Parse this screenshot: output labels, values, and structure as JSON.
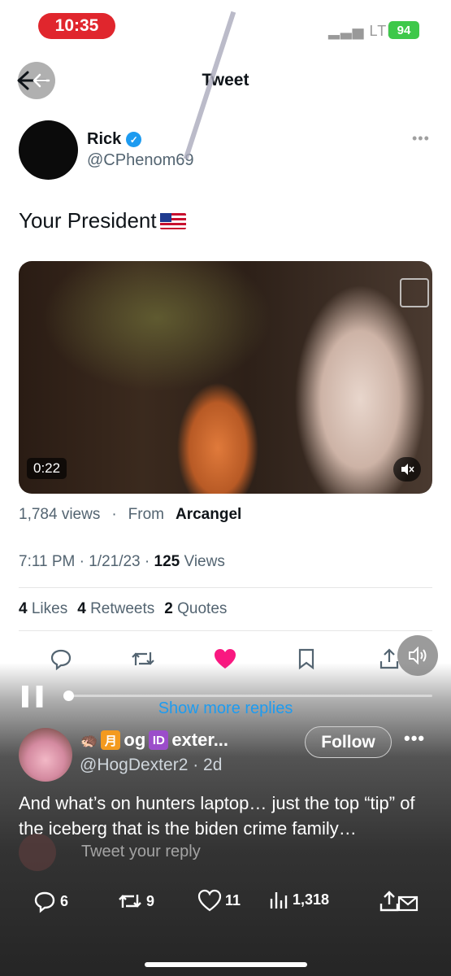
{
  "status_bar": {
    "time": "10:35",
    "network": "LTE",
    "battery": "94"
  },
  "header": {
    "title": "Tweet"
  },
  "tweet": {
    "author_name": "Rick",
    "author_handle": "@CPhenom69",
    "text": "Your President",
    "video_duration": "0:22",
    "views": "1,784 views",
    "separator": "·",
    "from_label": "From",
    "from_source": "Arcangel",
    "timestamp": "7:11 PM · 1/21/23 ·",
    "view_count": "125",
    "view_label": "Views",
    "likes_count": "4",
    "likes_label": "Likes",
    "retweets_count": "4",
    "retweets_label": "Retweets",
    "quotes_count": "2",
    "quotes_label": "Quotes"
  },
  "overlay": {
    "show_more": "Show more replies"
  },
  "reply": {
    "name_prefix": "og",
    "name_suffix": "exter...",
    "handle": "@HogDexter2 · 2d",
    "follow_label": "Follow",
    "text": "And what’s on hunters laptop… just the top “tip” of the iceberg that is the biden crime family…",
    "compose_placeholder": "Tweet your reply",
    "comments": "6",
    "retweets": "9",
    "likes": "11",
    "views": "1,318"
  },
  "colors": {
    "accent": "#1d9bf0",
    "like": "#f91880",
    "time_pill": "#e0262d",
    "battery": "#3ec84a"
  },
  "icons": [
    "back-arrow-icon",
    "verified-badge-icon",
    "more-icon",
    "mute-icon",
    "reply-icon",
    "retweet-icon",
    "heart-icon",
    "bookmark-icon",
    "share-icon",
    "speaker-icon",
    "pause-icon",
    "views-icon"
  ]
}
